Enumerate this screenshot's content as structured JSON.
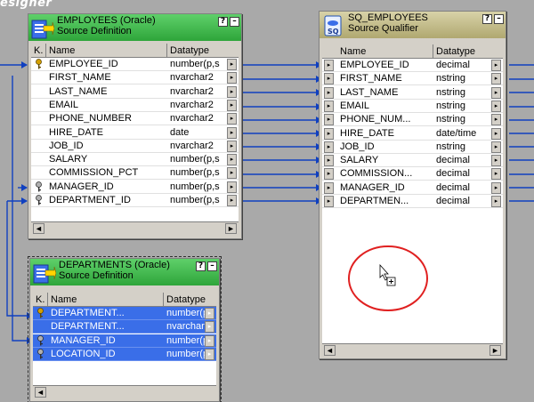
{
  "canvas": {
    "title": "esigner",
    "bg_color": "#a9a9a9",
    "link_color": "#1040c0"
  },
  "employees": {
    "title_line1": "EMPLOYEES (Oracle)",
    "title_line2": "Source Definition",
    "title_color": "#3fb84a",
    "help_label": "?",
    "min_label": "–",
    "columns": {
      "key": "K.",
      "name": "Name",
      "datatype": "Datatype"
    },
    "rows": [
      {
        "key": "key-icon",
        "name": "EMPLOYEE_ID",
        "datatype": "number(p,s"
      },
      {
        "key": "",
        "name": "FIRST_NAME",
        "datatype": "nvarchar2"
      },
      {
        "key": "",
        "name": "LAST_NAME",
        "datatype": "nvarchar2"
      },
      {
        "key": "",
        "name": "EMAIL",
        "datatype": "nvarchar2"
      },
      {
        "key": "",
        "name": "PHONE_NUMBER",
        "datatype": "nvarchar2"
      },
      {
        "key": "",
        "name": "HIRE_DATE",
        "datatype": "date"
      },
      {
        "key": "",
        "name": "JOB_ID",
        "datatype": "nvarchar2"
      },
      {
        "key": "",
        "name": "SALARY",
        "datatype": "number(p,s"
      },
      {
        "key": "",
        "name": "COMMISSION_PCT",
        "datatype": "number(p,s"
      },
      {
        "key": "foreign-key-icon",
        "name": "MANAGER_ID",
        "datatype": "number(p,s"
      },
      {
        "key": "foreign-key-icon",
        "name": "DEPARTMENT_ID",
        "datatype": "number(p,s"
      }
    ]
  },
  "sq_employees": {
    "title_line1": "SQ_EMPLOYEES",
    "title_line2": "Source Qualifier",
    "title_color": "#c8c090",
    "help_label": "?",
    "min_label": "–",
    "columns": {
      "name": "Name",
      "datatype": "Datatype"
    },
    "rows": [
      {
        "name": "EMPLOYEE_ID",
        "datatype": "decimal"
      },
      {
        "name": "FIRST_NAME",
        "datatype": "nstring"
      },
      {
        "name": "LAST_NAME",
        "datatype": "nstring"
      },
      {
        "name": "EMAIL",
        "datatype": "nstring"
      },
      {
        "name": "PHONE_NUM...",
        "datatype": "nstring"
      },
      {
        "name": "HIRE_DATE",
        "datatype": "date/time"
      },
      {
        "name": "JOB_ID",
        "datatype": "nstring"
      },
      {
        "name": "SALARY",
        "datatype": "decimal"
      },
      {
        "name": "COMMISSION...",
        "datatype": "decimal"
      },
      {
        "name": "MANAGER_ID",
        "datatype": "decimal"
      },
      {
        "name": "DEPARTMEN...",
        "datatype": "decimal"
      }
    ]
  },
  "departments": {
    "title_line1": "DEPARTMENTS (Oracle)",
    "title_line2": "Source Definition",
    "title_color": "#3fb84a",
    "help_label": "?",
    "min_label": "–",
    "columns": {
      "key": "K.",
      "name": "Name",
      "datatype": "Datatype"
    },
    "rows": [
      {
        "key": "key-icon",
        "name": "DEPARTMENT...",
        "datatype": "number(p"
      },
      {
        "key": "",
        "name": "DEPARTMENT...",
        "datatype": "nvarchar2"
      },
      {
        "key": "foreign-key-icon",
        "name": "MANAGER_ID",
        "datatype": "number(p"
      },
      {
        "key": "foreign-key-icon",
        "name": "LOCATION_ID",
        "datatype": "number(p"
      }
    ]
  },
  "scroll": {
    "left_label": "◄",
    "right_label": "►"
  },
  "port_label": "▸",
  "highlight": {
    "circle_color": "#e02020"
  }
}
